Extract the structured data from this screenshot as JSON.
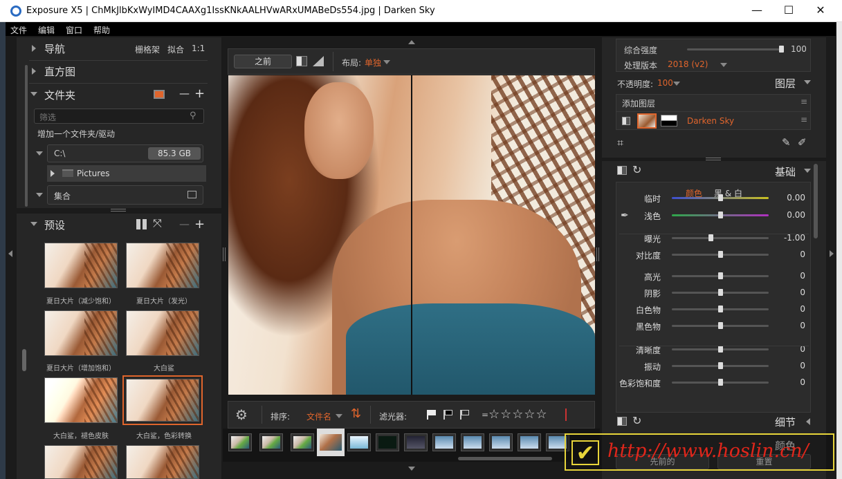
{
  "window": {
    "title": "Exposure X5 | ChMkJlbKxWyIMD4CAAXg1IssKNkAALHVwARxUMABeDs554.jpg | Darken Sky",
    "minimize": "—",
    "maximize": "☐",
    "close": "✕"
  },
  "menu": [
    "文件",
    "编辑",
    "窗口",
    "帮助"
  ],
  "left": {
    "nav": {
      "title": "导航",
      "grid": "栅格架",
      "fit": "拟合",
      "one": "1:1"
    },
    "histogram": {
      "title": "直方图"
    },
    "folders": {
      "title": "文件夹",
      "minus": "—",
      "plus": "+",
      "filter_placeholder": "筛选",
      "add": "增加一个文件夹/驱动",
      "drive": "C:\\",
      "drive_size": "85.3 GB",
      "subfolder": "Pictures",
      "collections": "集合"
    },
    "presets": {
      "title": "预设",
      "minus": "—",
      "plus": "+",
      "items": [
        "夏日大片（减少饱和）",
        "夏日大片（发光）",
        "夏日大片（增加饱和）",
        "大白鲨",
        "大白鲨，褪色皮肤",
        "大白鲨，色彩转换",
        "",
        ""
      ]
    }
  },
  "center": {
    "before_btn": "之前",
    "layout_label": "布局:",
    "layout_value": "单独",
    "sort_label": "排序:",
    "sort_value": "文件名",
    "filter_label": "滤光器:",
    "equals": "=",
    "stars": "☆☆☆☆☆"
  },
  "right": {
    "overall_label": "综合强度",
    "overall_value": "100",
    "overall_level": 1.0,
    "version_label": "处理版本",
    "version_value": "2018 (v2)",
    "opacity_label": "不透明度:",
    "opacity_value": "100",
    "layers_title": "图层",
    "add_layer": "添加图层",
    "layer_name": "Darken Sky",
    "basic_title": "基础",
    "tab_color": "颜色",
    "tab_bw": "黑 & 白",
    "sliders": [
      {
        "label": "临时",
        "value": "0.00",
        "level": 0.5
      },
      {
        "label": "浅色",
        "value": "0.00",
        "level": 0.5
      },
      {
        "label": "曝光",
        "value": "-1.00",
        "level": 0.4
      },
      {
        "label": "对比度",
        "value": "0",
        "level": 0.5
      },
      {
        "label": "高光",
        "value": "0",
        "level": 0.5
      },
      {
        "label": "阴影",
        "value": "0",
        "level": 0.5
      },
      {
        "label": "白色物",
        "value": "0",
        "level": 0.5
      },
      {
        "label": "黑色物",
        "value": "0",
        "level": 0.5
      },
      {
        "label": "清晰度",
        "value": "0",
        "level": 0.5
      },
      {
        "label": "振动",
        "value": "0",
        "level": 0.5
      },
      {
        "label": "色彩饱和度",
        "value": "0",
        "level": 0.5
      }
    ],
    "detail_title": "细节",
    "color_title": "颜色",
    "prev_btn": "先前的",
    "reset_btn": "重置"
  },
  "watermark": "http://www.hoslin.cn/",
  "colors": {
    "accent": "#e0652c",
    "panel": "#262626",
    "bg": "#1b1b1b"
  }
}
